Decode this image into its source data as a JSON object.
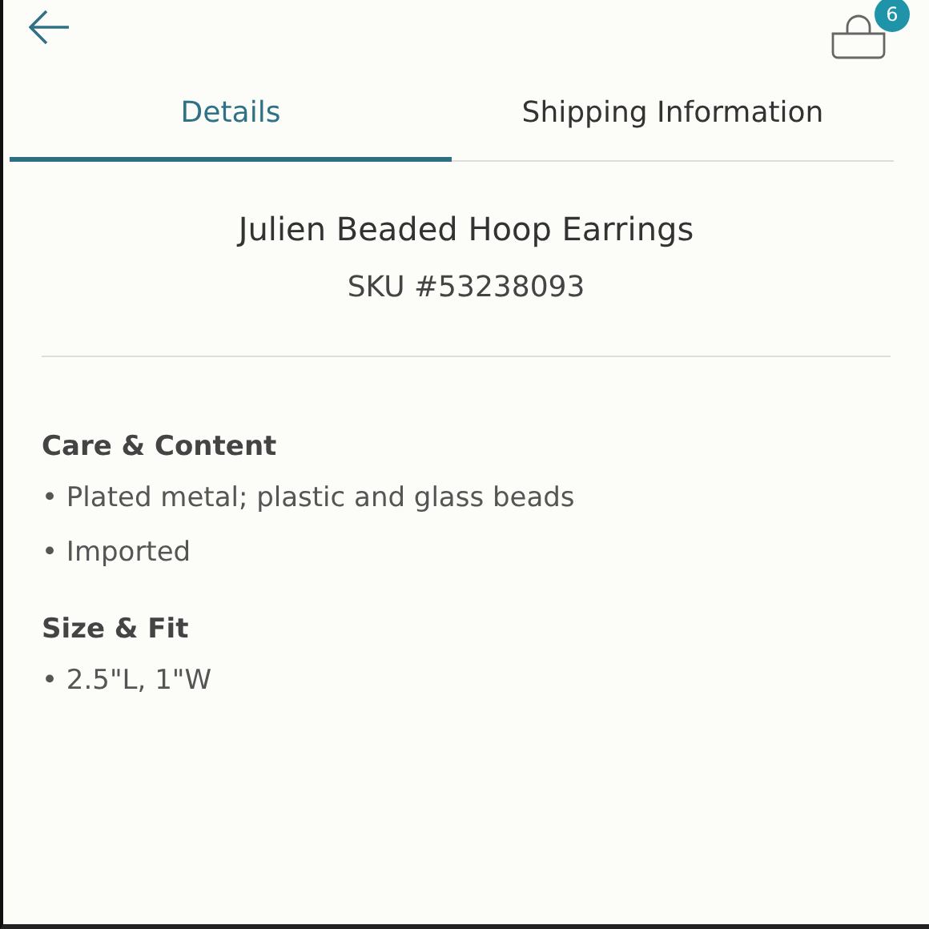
{
  "header": {
    "cart_count": "6"
  },
  "tabs": [
    {
      "label": "Details",
      "selected": true
    },
    {
      "label": "Shipping Information",
      "selected": false
    }
  ],
  "product": {
    "name": "Julien Beaded Hoop Earrings",
    "sku": "SKU #53238093"
  },
  "sections": [
    {
      "heading": "Care & Content",
      "items": [
        "• Plated metal; plastic and glass beads",
        "• Imported"
      ]
    },
    {
      "heading": "Size & Fit",
      "items": [
        "• 2.5\"L, 1\"W"
      ]
    }
  ]
}
